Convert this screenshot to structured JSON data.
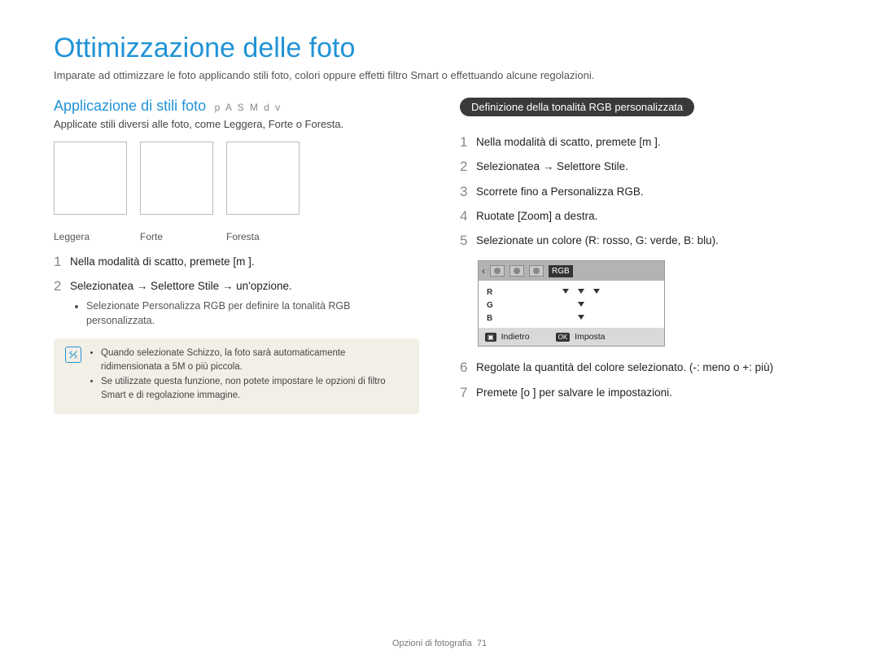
{
  "title": "Ottimizzazione delle foto",
  "subtitle": "Imparate ad ottimizzare le foto applicando stili foto, colori oppure effetti filtro Smart o effettuando alcune regolazioni.",
  "left": {
    "heading": "Applicazione di stili foto",
    "modes": "p A S M d v",
    "desc": "Applicate stili diversi alle foto, come Leggera, Forte o Foresta.",
    "styles": [
      "Leggera",
      "Forte",
      "Foresta"
    ],
    "steps": [
      {
        "n": "1",
        "t": "Nella modalità di scatto, premete [m      ]."
      },
      {
        "n": "2",
        "t": "Selezionatea     → Selettore Stile → un'opzione.",
        "sub": "Selezionate Personalizza RGB per definire la tonalità RGB personalizzata."
      }
    ],
    "notes": [
      "Quando selezionate Schizzo, la foto sarà automaticamente ridimensionata a 5M o più piccola.",
      "Se utilizzate questa funzione, non potete impostare le opzioni di filtro Smart e di regolazione immagine."
    ]
  },
  "right": {
    "pill": "Definizione della tonalità RGB personalizzata",
    "steps_a": [
      {
        "n": "1",
        "t": "Nella modalità di scatto, premete [m      ]."
      },
      {
        "n": "2",
        "t": "Selezionatea     → Selettore Stile."
      },
      {
        "n": "3",
        "t": "Scorrete fino a Personalizza RGB."
      },
      {
        "n": "4",
        "t": "Ruotate [Zoom] a destra."
      },
      {
        "n": "5",
        "t": "Selezionate un colore (R: rosso, G: verde, B: blu)."
      }
    ],
    "panel": {
      "rgb_label": "RGB",
      "ch": [
        "R",
        "G",
        "B"
      ],
      "back_label": "Indietro",
      "set_label": "Imposta",
      "back_sym": "▣",
      "set_sym": "OK"
    },
    "steps_b": [
      {
        "n": "6",
        "t": "Regolate la quantità del colore selezionato. (-: meno o +: più)"
      },
      {
        "n": "7",
        "t": "Premete [o ] per salvare le impostazioni."
      }
    ]
  },
  "footer": {
    "section": "Opzioni di fotografia",
    "page": "71"
  }
}
